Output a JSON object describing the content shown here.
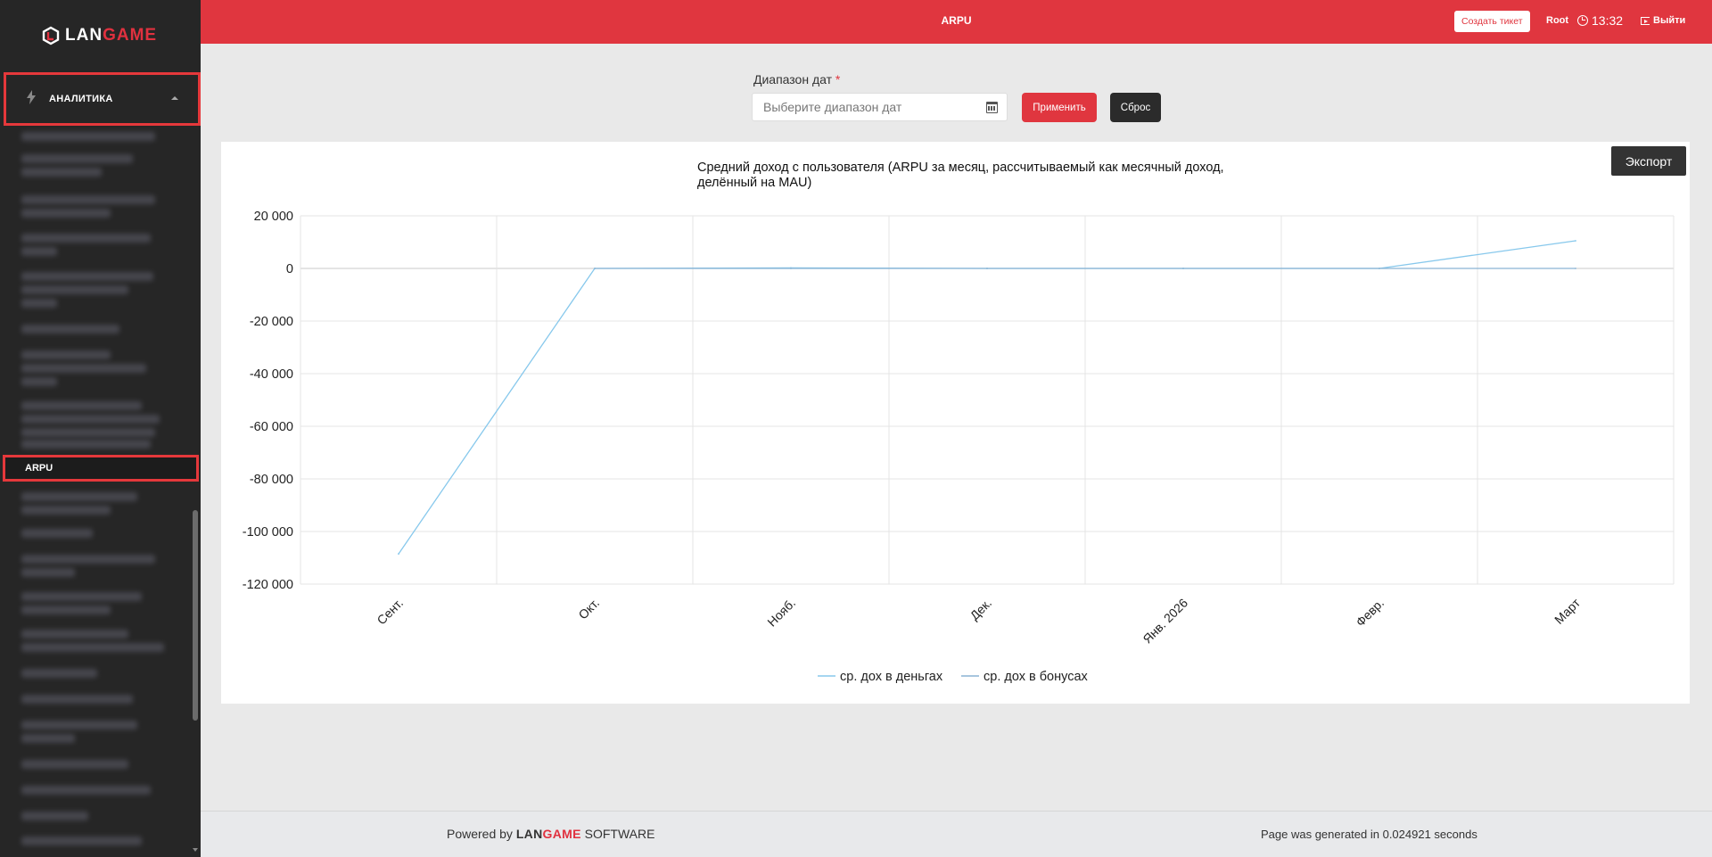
{
  "sidebar": {
    "logo_lan": "LAN",
    "logo_game": "GAME",
    "section": {
      "label": "АНАЛИТИКА",
      "icon": "bolt-icon"
    },
    "active_item": "ARPU"
  },
  "header": {
    "title": "ARPU",
    "ticket_button": "Создать тикет",
    "user": "Root",
    "time": "13:32",
    "logout": "Выйти",
    "accent": "#e0363f"
  },
  "filter": {
    "label": "Диапазон дат",
    "required_mark": "*",
    "date_placeholder": "Выберите диапазон дат",
    "apply_label": "Применить",
    "reset_label": "Сброс"
  },
  "export_label": "Экспорт",
  "chart_data": {
    "type": "line",
    "title_line1": "Средний доход с пользователя (ARPU за месяц, рассчитываемый как месячный доход,",
    "title_line2": "делённый на MAU)",
    "categories": [
      "Сент.",
      "Окт.",
      "Нояб.",
      "Дек.",
      "Янв. 2026",
      "Февр.",
      "Март"
    ],
    "ylim": [
      -120000,
      20000
    ],
    "yticks": [
      20000,
      0,
      -20000,
      -40000,
      -60000,
      -80000,
      -100000,
      -120000
    ],
    "ytick_labels": [
      "20 000",
      "0",
      "-20 000",
      "-40 000",
      "-60 000",
      "-80 000",
      "-100 000",
      "-120 000"
    ],
    "grid": true,
    "legend_position": "bottom",
    "series": [
      {
        "name": "ср. дох в деньгах",
        "color": "#87c8ec",
        "values": [
          -108500,
          0,
          200,
          0,
          0,
          0,
          10500
        ]
      },
      {
        "name": "ср. дох в бонусах",
        "color": "#8ab4d4",
        "values": [
          null,
          0,
          0,
          0,
          0,
          0,
          0
        ]
      }
    ]
  },
  "footer": {
    "powered_prefix": "Powered by",
    "brand_lan": "LAN",
    "brand_game": "GAME",
    "brand_suffix": "SOFTWARE",
    "generated": "Page was generated in 0.024921 seconds"
  }
}
